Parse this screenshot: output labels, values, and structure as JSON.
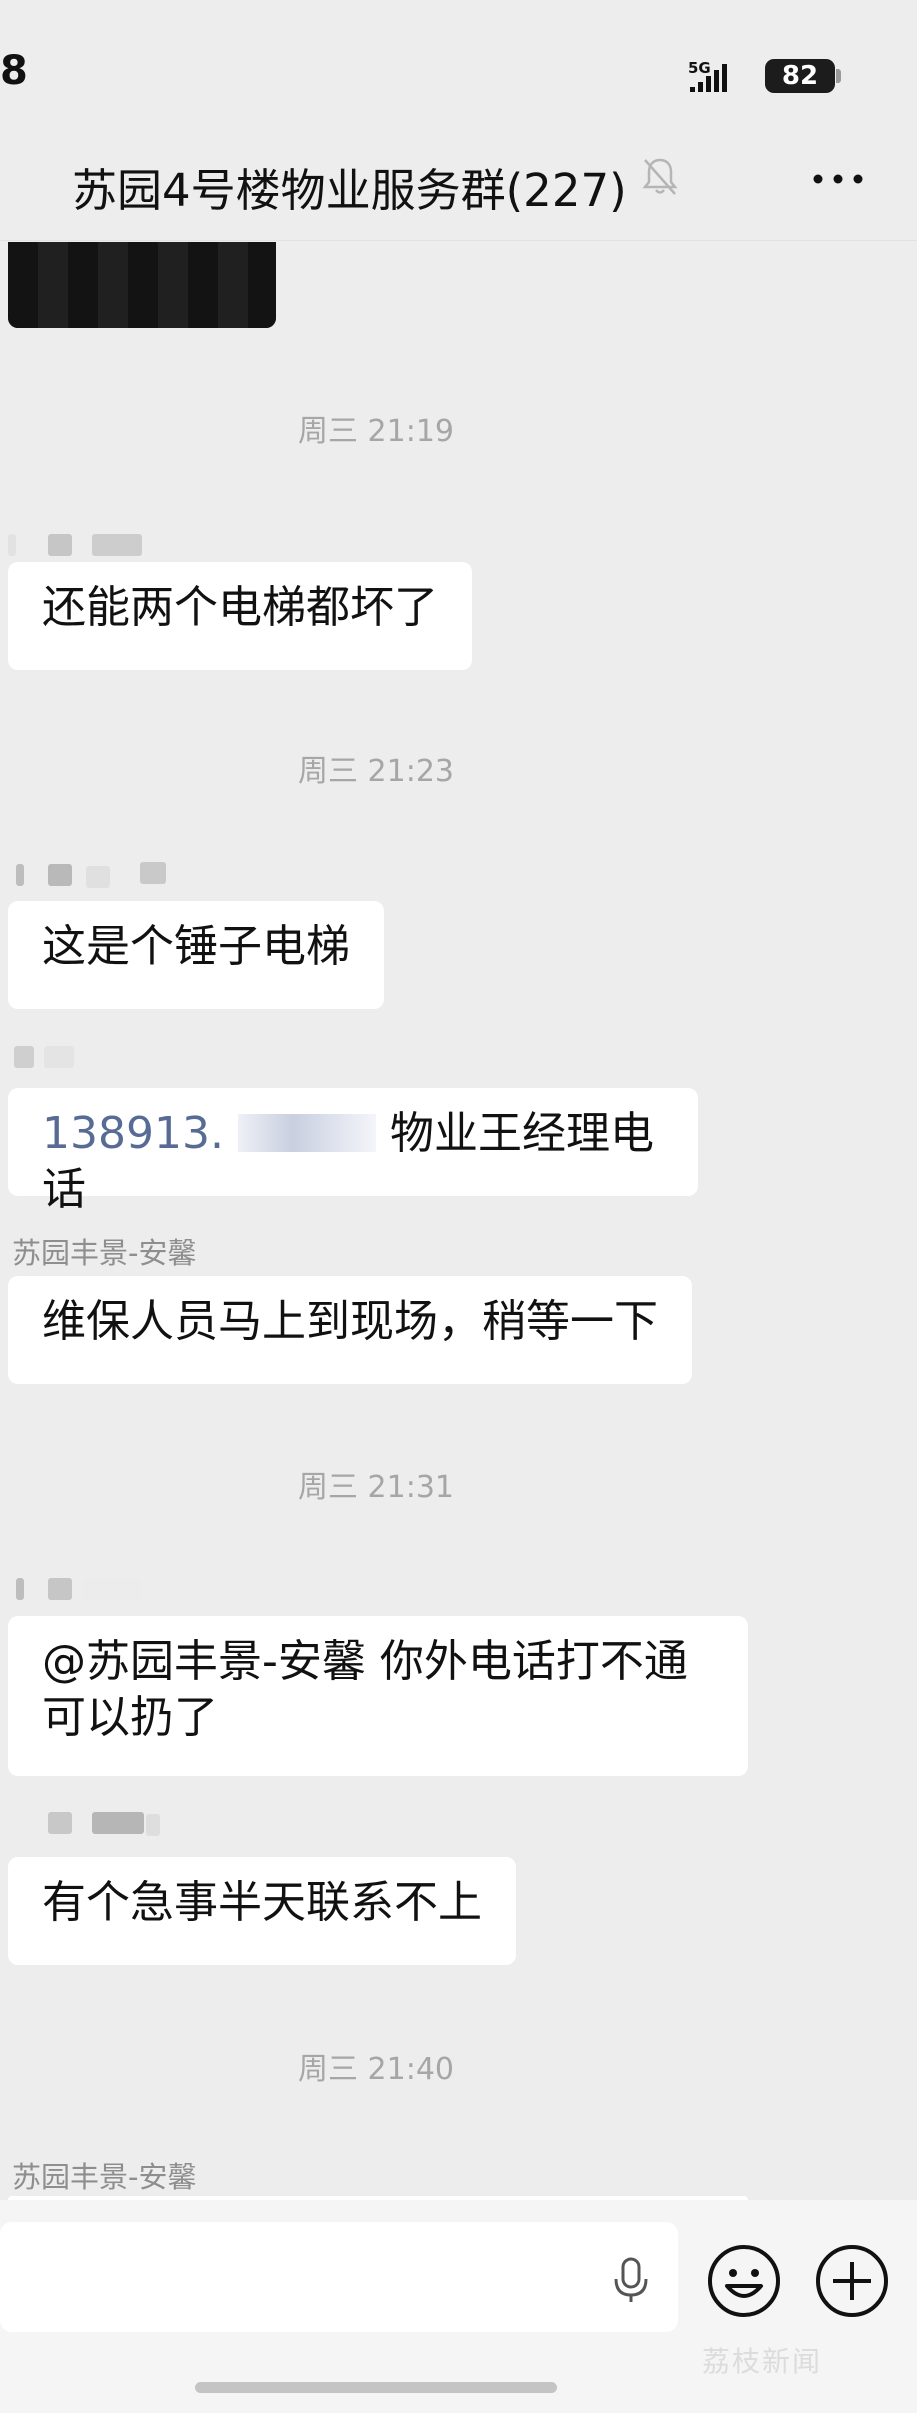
{
  "status_bar": {
    "time": "8",
    "network": "5G",
    "battery": "82"
  },
  "header": {
    "title": "苏园4号楼物业服务群(227)"
  },
  "messages": {
    "ts1": "周三 21:19",
    "m1": {
      "text": "还能两个电梯都坏了"
    },
    "ts2": "周三 21:23",
    "m2": {
      "text": "这是个锤子电梯"
    },
    "m3": {
      "phone": "138913.",
      "text": "物业王经理电话"
    },
    "m4": {
      "sender": "苏园丰景-安馨",
      "text": "维保人员马上到现场，稍等一下"
    },
    "ts3": "周三 21:31",
    "m5": {
      "line1": "@苏园丰景-安馨  你外电话打不通",
      "line2": "可以扔了"
    },
    "m6": {
      "text": "有个急事半天联系不上"
    },
    "ts4": "周三 21:40",
    "m7": {
      "sender": "苏园丰景-安馨"
    }
  },
  "input_bar": {
    "watermark": "荔枝新闻"
  },
  "colors": {
    "background": "#ededed",
    "bubble": "#ffffff",
    "phone_link": "#576b95",
    "timestamp": "#a6a6a6"
  }
}
